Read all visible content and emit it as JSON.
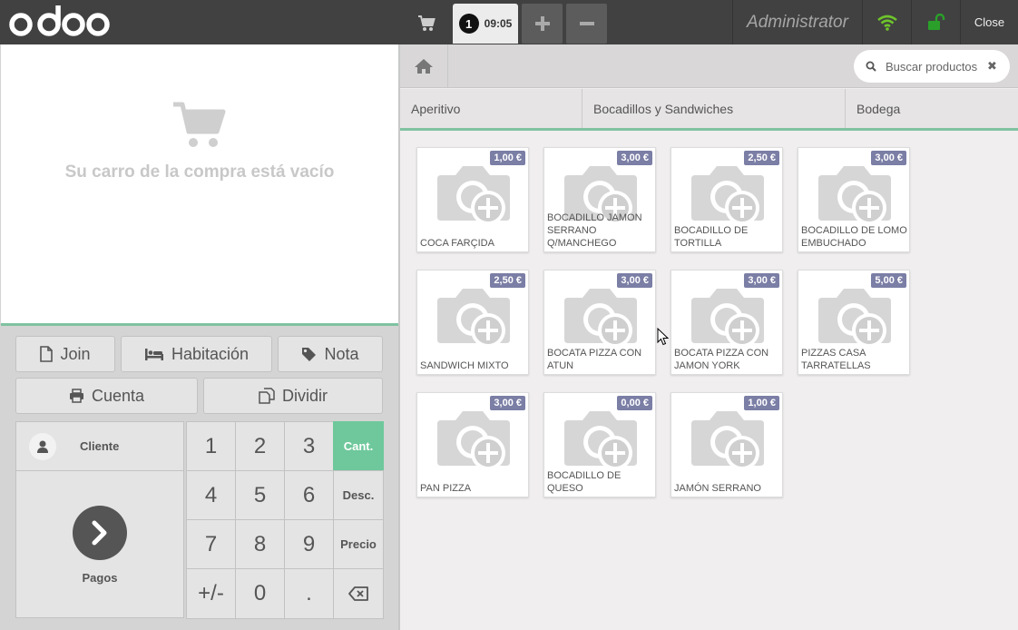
{
  "topbar": {
    "logo_text": "odoo",
    "order_number": "1",
    "order_time": "09:05",
    "user": "Administrator",
    "close_label": "Close",
    "icons": {
      "cart": "shopping-cart-icon",
      "plus": "plus-icon",
      "minus": "minus-icon",
      "wifi": "wifi-icon",
      "lock": "unlock-icon"
    },
    "colors": {
      "wifi": "#6ec32b",
      "lock": "#2aa02a"
    }
  },
  "order": {
    "empty_text": "Su carro de la compra está vacío"
  },
  "controls": {
    "join": "Join",
    "habitacion": "Habitación",
    "nota": "Nota",
    "cuenta": "Cuenta",
    "dividir": "Dividir"
  },
  "paypad": {
    "cliente": "Cliente",
    "pagos": "Pagos"
  },
  "numpad": {
    "keys": [
      "1",
      "2",
      "3",
      "4",
      "5",
      "6",
      "7",
      "8",
      "9",
      "+/-",
      "0",
      "."
    ],
    "modes": [
      "Cant.",
      "Desc.",
      "Precio"
    ],
    "active_mode": "Cant.",
    "accent": "#6ec89b"
  },
  "search": {
    "placeholder": "Buscar productos",
    "clear": "✖"
  },
  "categories": [
    "Aperitivo",
    "Bocadillos y Sandwiches",
    "Bodega"
  ],
  "products": [
    {
      "name": "COCA FARÇIDA",
      "price": "1,00 €"
    },
    {
      "name": "BOCADILLO JAMON SERRANO Q/MANCHEGO",
      "price": "3,00 €"
    },
    {
      "name": "BOCADILLO DE TORTILLA",
      "price": "2,50 €"
    },
    {
      "name": "BOCADILLO DE LOMO EMBUCHADO",
      "price": "3,00 €"
    },
    {
      "name": "SANDWICH MIXTO",
      "price": "2,50 €"
    },
    {
      "name": "BOCATA PIZZA CON ATUN",
      "price": "3,00 €"
    },
    {
      "name": "BOCATA PIZZA CON JAMON YORK",
      "price": "3,00 €"
    },
    {
      "name": "PIZZAS CASA TARRATELLAS",
      "price": "5,00 €"
    },
    {
      "name": "PAN PIZZA",
      "price": "3,00 €"
    },
    {
      "name": "BOCADILLO DE QUESO",
      "price": "0,00 €"
    },
    {
      "name": "JAMÓN SERRANO",
      "price": "1,00 €"
    }
  ],
  "price_badge_color": "#7b7ea5"
}
